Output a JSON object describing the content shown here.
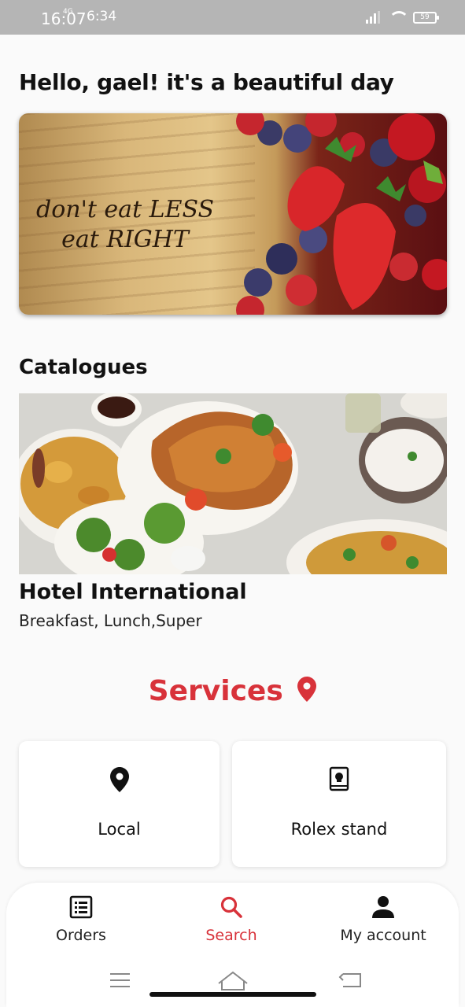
{
  "status_bar": {
    "time_overlay": "16:07",
    "time": "6:34",
    "network": "4G",
    "battery": "59"
  },
  "greeting": "Hello, gael! it's a beautiful day",
  "banner": {
    "line1": "don't eat LESS",
    "line2": "eat RIGHT"
  },
  "catalogues": {
    "title": "Catalogues",
    "items": [
      {
        "name": "Hotel International",
        "description": "Breakfast, Lunch,Super"
      }
    ]
  },
  "services": {
    "title": "Services",
    "cards": [
      {
        "label": "Local",
        "icon": "location-pin-icon"
      },
      {
        "label": "Rolex stand",
        "icon": "menu-book-icon"
      }
    ]
  },
  "bottom_nav": {
    "items": [
      {
        "label": "Orders",
        "icon": "list-icon",
        "active": false
      },
      {
        "label": "Search",
        "icon": "search-icon",
        "active": true
      },
      {
        "label": "My account",
        "icon": "person-icon",
        "active": false
      }
    ]
  },
  "colors": {
    "accent": "#d8323a",
    "text": "#111111",
    "background": "#fafafa"
  }
}
